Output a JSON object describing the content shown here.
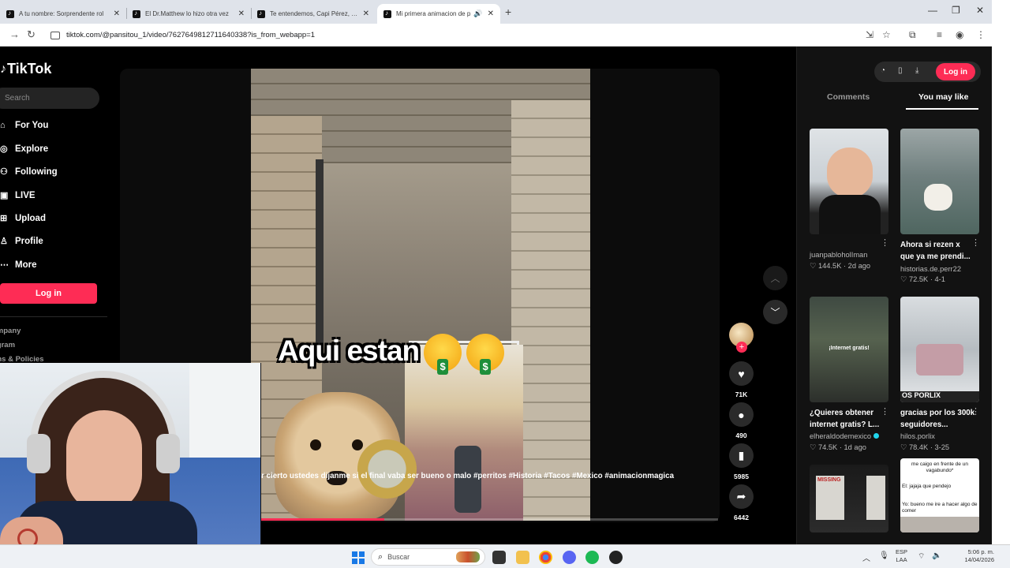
{
  "browser": {
    "tabs": [
      {
        "title": "A tu nombre: Sorprendente rol",
        "close": "✕"
      },
      {
        "title": "El Dr.Matthew lo hizo otra vez",
        "close": "✕"
      },
      {
        "title": "Te entendemos, Capi Pérez, no",
        "close": "✕"
      },
      {
        "title": "Mi primera animacion de p",
        "close": "✕"
      }
    ],
    "new_tab": "+",
    "url": "tiktok.com/@pansitou_1/video/7627649812711640338?is_from_webapp=1"
  },
  "sidebar": {
    "logo": "TikTok",
    "search_placeholder": "Search",
    "nav": [
      {
        "label": "For You",
        "icon": "home-icon"
      },
      {
        "label": "Explore",
        "icon": "compass-icon"
      },
      {
        "label": "Following",
        "icon": "people-icon"
      },
      {
        "label": "LIVE",
        "icon": "live-icon"
      },
      {
        "label": "Upload",
        "icon": "upload-icon"
      },
      {
        "label": "Profile",
        "icon": "person-icon"
      },
      {
        "label": "More",
        "icon": "more-icon"
      }
    ],
    "login": "Log in",
    "footer": [
      "ompany",
      "ogram",
      "rms & Policies"
    ]
  },
  "video": {
    "overlay_text": "Aqui estan",
    "caption": "r cierto ustedes dijanme si el final vaba ser bueno o malo #perritos #Historia #Tacos #Mexico #animacionmagica",
    "progress": 0.27,
    "follow": "+",
    "likes": "71K",
    "comments": "490",
    "saves": "5985",
    "shares": "6442"
  },
  "right_panel": {
    "login": "Log in",
    "tab_comments": "Comments",
    "tab_you_may_like": "You may like",
    "cards": [
      {
        "title": "",
        "user": "juanpabloholIman",
        "likes": "144.5K",
        "date": "2d ago"
      },
      {
        "title": "Ahora si rezen x que ya me prendi...",
        "user": "historias.de.perr22",
        "likes": "72.5K",
        "date": "4-1"
      },
      {
        "title": "¿Quieres obtener internet gratis? L...",
        "user": "elheraldodemexico",
        "likes": "74.5K",
        "date": "1d ago"
      },
      {
        "title": "gracias por los 300k seguidores...",
        "user": "hilos.porlix",
        "likes": "78.4K",
        "date": "3-25"
      }
    ],
    "thumb_texts": {
      "c3": "¡Internet gratis!",
      "c4": "OS PORLIX",
      "c6_a": "me caigo en frente de un vagabundo*",
      "c6_b": "El: jajaja que pendejo",
      "c6_c": "Yo: bueno me ire a hacer algo de comer",
      "c5": "MISSING"
    }
  },
  "taskbar": {
    "search": "Buscar",
    "lang_1": "ESP",
    "lang_2": "LAA",
    "time": "5:06 p. m.",
    "date": "14/04/2026"
  },
  "colors": {
    "accent": "#fe2c55",
    "page_bg": "#000000",
    "panel_bg": "#121212"
  }
}
